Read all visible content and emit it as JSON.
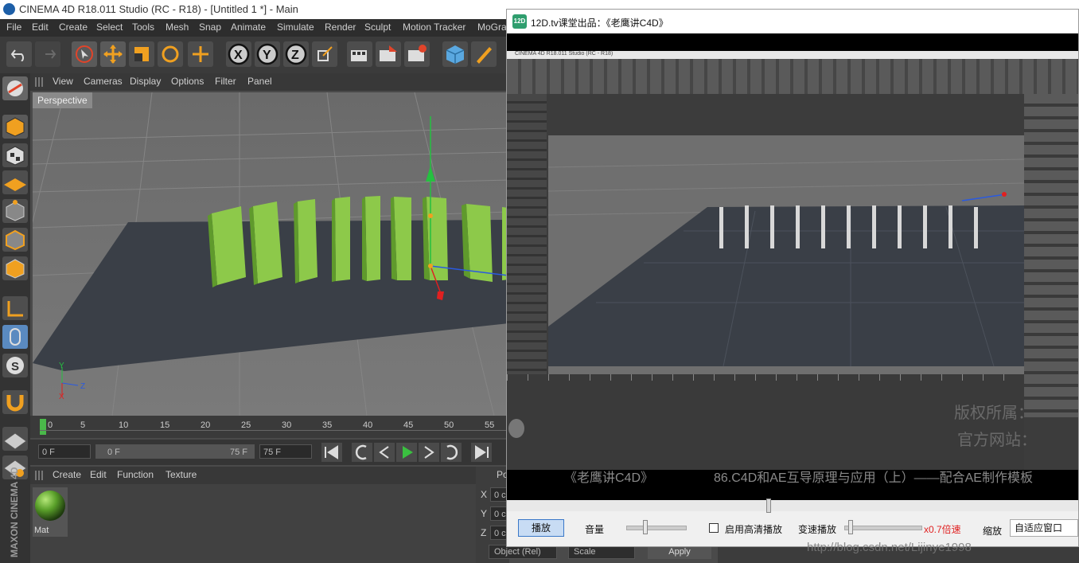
{
  "window": {
    "title": "CINEMA 4D R18.011 Studio (RC - R18) - [Untitled 1 *] - Main"
  },
  "menu": [
    "File",
    "Edit",
    "Create",
    "Select",
    "Tools",
    "Mesh",
    "Snap",
    "Animate",
    "Simulate",
    "Render",
    "Sculpt",
    "Motion Tracker",
    "MoGra"
  ],
  "viewport_menu": [
    "View",
    "Cameras",
    "Display",
    "Options",
    "Filter",
    "Panel"
  ],
  "viewport": {
    "label": "Perspective"
  },
  "timeline": {
    "ticks": [
      "0",
      "5",
      "10",
      "15",
      "20",
      "25",
      "30",
      "35",
      "40",
      "45",
      "50",
      "55"
    ]
  },
  "transport": {
    "current_frame": "0 F",
    "start_frame": "0 F",
    "end_frame_slider": "75 F",
    "end_frame": "75 F"
  },
  "material_menu": [
    "Create",
    "Edit",
    "Function",
    "Texture"
  ],
  "material": {
    "name": "Mat"
  },
  "attributes": {
    "axis_labels": [
      "X",
      "Y",
      "Z"
    ],
    "field_value": "0 c",
    "object_dropdown": "Object (Rel)",
    "scale_dropdown": "Scale",
    "apply_label": "Apply",
    "panel_header": "Po"
  },
  "branding": {
    "vertical": "MAXON CINEMA 4D"
  },
  "player": {
    "logo": "12D",
    "title": "12D.tv课堂出品：《老鹰讲C4D》",
    "inner_title": "CINEMA 4D R18.011 Studio (RC - R18)",
    "watermark_top": "版权所属：",
    "watermark_mid": "官方网站：",
    "subtitle_left": "《老鹰讲C4D》",
    "subtitle_right": "86.C4D和AE互导原理与应用（上）——配合AE制作模板",
    "play_button": "播放",
    "volume_label": "音量",
    "hd_label": "启用高清播放",
    "speed_label": "变速播放",
    "speed_value": "x0.7倍速",
    "zoom_label": "缩放",
    "zoom_value": "自适应窗口",
    "colors": {
      "speed": "#e02020"
    }
  },
  "url_watermark": "http://blog.csdn.net/Lijinye1998"
}
